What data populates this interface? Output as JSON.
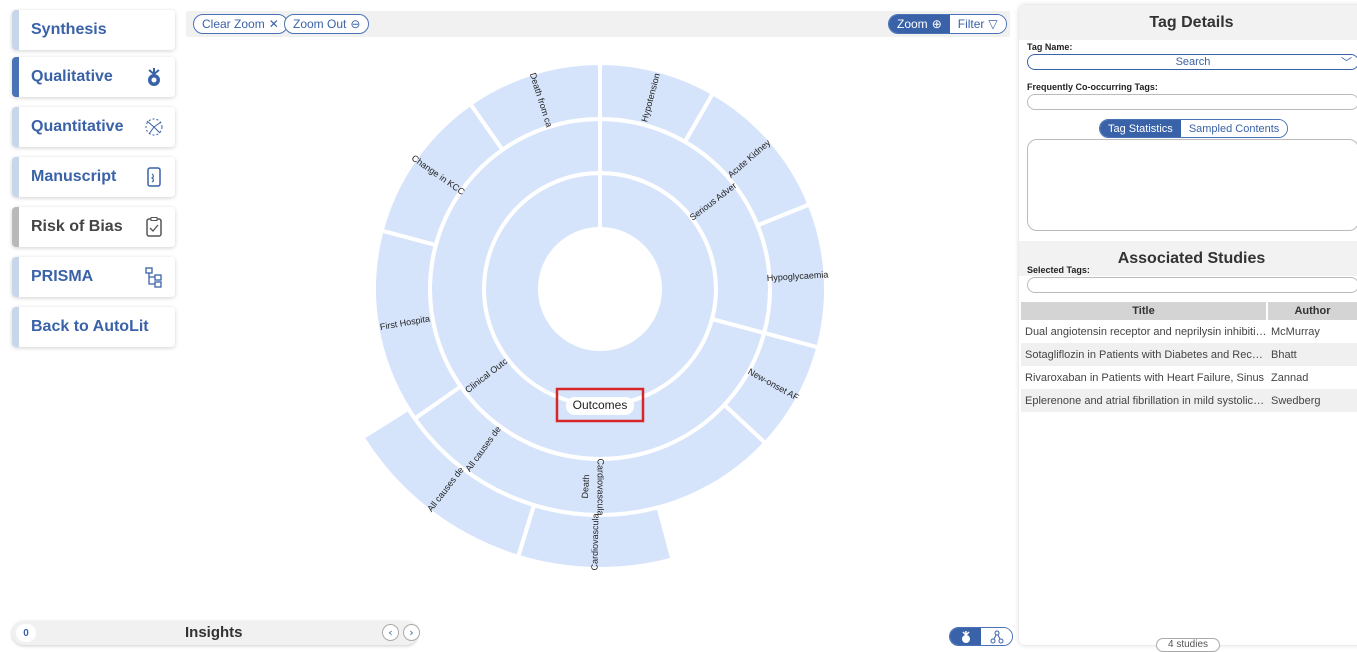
{
  "sidebar": {
    "items": [
      {
        "label": "Synthesis",
        "icon": "none"
      },
      {
        "label": "Qualitative",
        "icon": "qualitative-chart-icon"
      },
      {
        "label": "Quantitative",
        "icon": "quantitative-burst-icon"
      },
      {
        "label": "Manuscript",
        "icon": "document-icon"
      },
      {
        "label": "Risk of Bias",
        "icon": "clipboard-check-icon"
      },
      {
        "label": "PRISMA",
        "icon": "flow-diagram-icon"
      },
      {
        "label": "Back to AutoLit",
        "icon": "none"
      }
    ]
  },
  "toolbar": {
    "clear_zoom": "Clear Zoom",
    "zoom_out": "Zoom Out",
    "zoom": "Zoom",
    "filter": "Filter"
  },
  "chart_data": {
    "type": "sunburst",
    "center_label": "Outcomes",
    "rings": [
      {
        "level": 1,
        "segments": [
          {
            "label": "Outcomes",
            "share": 1.0
          }
        ]
      },
      {
        "level": 2,
        "segments": [
          {
            "label": "Serious Adver",
            "share": 0.29
          },
          {
            "label": "Clinical Outc",
            "share": 0.71
          }
        ]
      },
      {
        "level": 3,
        "segments": [
          {
            "label": "Hypotension",
            "share": 0.081
          },
          {
            "label": "Acute Kidney",
            "share": 0.081
          },
          {
            "label": "Hypoglycaemia",
            "share": 0.081
          },
          {
            "label": "New-onset AF",
            "share": 0.081
          },
          {
            "label": "Cardiovascula",
            "share": 0.081
          },
          {
            "label": "All causes de",
            "share": 0.081
          },
          {
            "label": "First Hospita",
            "share": 0.081
          },
          {
            "label": "Change in KCC",
            "share": 0.081
          },
          {
            "label": "Death from ca",
            "share": 0.081
          }
        ]
      },
      {
        "level": 4,
        "segments": [
          {
            "label": "Death",
            "share": 0.162
          }
        ]
      }
    ],
    "colors": {
      "segment": "#d6e4fb",
      "stroke": "#ffffff",
      "highlight": "#d62728"
    }
  },
  "insights": {
    "count": "0",
    "title": "Insights"
  },
  "panel": {
    "tag_details_title": "Tag Details",
    "tag_name_label": "Tag Name:",
    "search_placeholder": "Search",
    "cooccurring_label": "Frequently Co-occurring Tags:",
    "tab_statistics": "Tag Statistics",
    "tab_sampled": "Sampled Contents",
    "associated_title": "Associated Studies",
    "selected_tags_label": "Selected Tags:",
    "columns": {
      "title": "Title",
      "author": "Author"
    },
    "studies": [
      {
        "title": "Dual angiotensin receptor and neprilysin inhibition",
        "author": "McMurray"
      },
      {
        "title": "Sotagliflozin in Patients with Diabetes and Recent",
        "author": "Bhatt"
      },
      {
        "title": "Rivaroxaban in Patients with Heart Failure, Sinus",
        "author": "Zannad"
      },
      {
        "title": "Eplerenone and atrial fibrillation in mild systolic heart failure",
        "author": "Swedberg"
      }
    ],
    "study_count": "4 studies"
  },
  "colors": {
    "accent": "#3a62a8",
    "panel_header": "#f2f2f2"
  }
}
